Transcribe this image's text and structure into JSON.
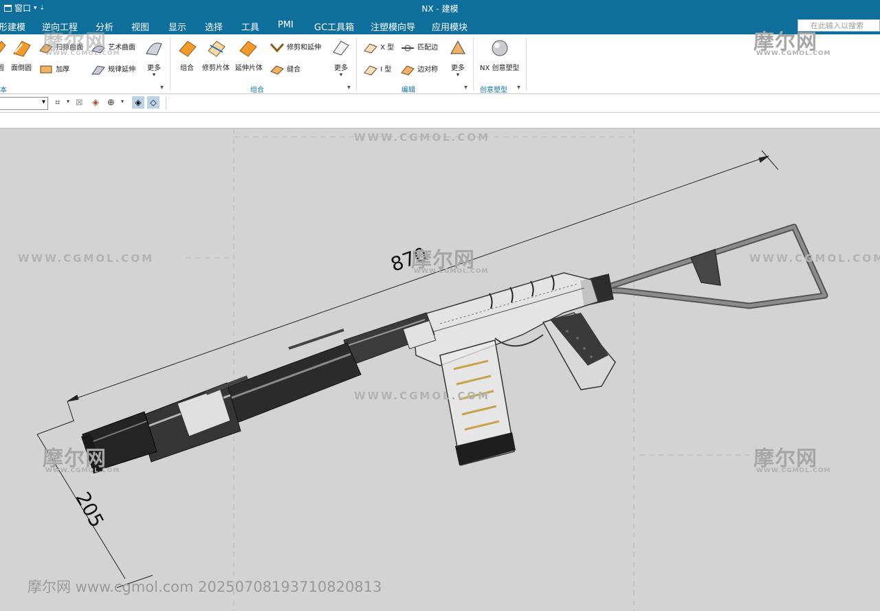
{
  "window": {
    "menu_label": "窗口",
    "title": "NX - 建模"
  },
  "menubar": {
    "items": [
      "形建模",
      "逆向工程",
      "分析",
      "视图",
      "显示",
      "选择",
      "工具",
      "PMI",
      "GC工具箱",
      "注塑模向导",
      "应用模块"
    ],
    "search_placeholder": "在此输入以搜索"
  },
  "ribbon": {
    "buttons": {
      "guide_surface": "扫掠曲面",
      "art_surface": "艺术曲面",
      "face_round": "面倒圆",
      "round": "圆",
      "thicken": "加厚",
      "law_extend": "规律延伸",
      "more1": "更多",
      "combine": "组合",
      "trim_sheet": "修剪片体",
      "trim_extend": "修剪和延伸",
      "extend_sheet": "延伸片体",
      "sew": "缝合",
      "more2": "更多",
      "x_form": "X 型",
      "match_edge": "匹配边",
      "i_form": "I 型",
      "edge_symmetry": "边对称",
      "more3": "更多",
      "nx_realize": "NX 创意塑型"
    },
    "groups": {
      "base": "本",
      "combine": "组合",
      "edit": "编辑",
      "realize": "创意塑型"
    }
  },
  "drawing": {
    "dim_length": "870",
    "dim_height": "205"
  },
  "watermarks": {
    "url": "WWW.CGMOL.COM",
    "cn": "摩尔网",
    "sub": "WWW.CGMOL.COM",
    "bottom": "摩尔网 www.cgmol.com 20250708193710820813"
  },
  "colors": {
    "title_bar": "#0e6f9c",
    "ribbon_group_label": "#0e6f9c",
    "viewport_bg": "#d3d3d3"
  }
}
